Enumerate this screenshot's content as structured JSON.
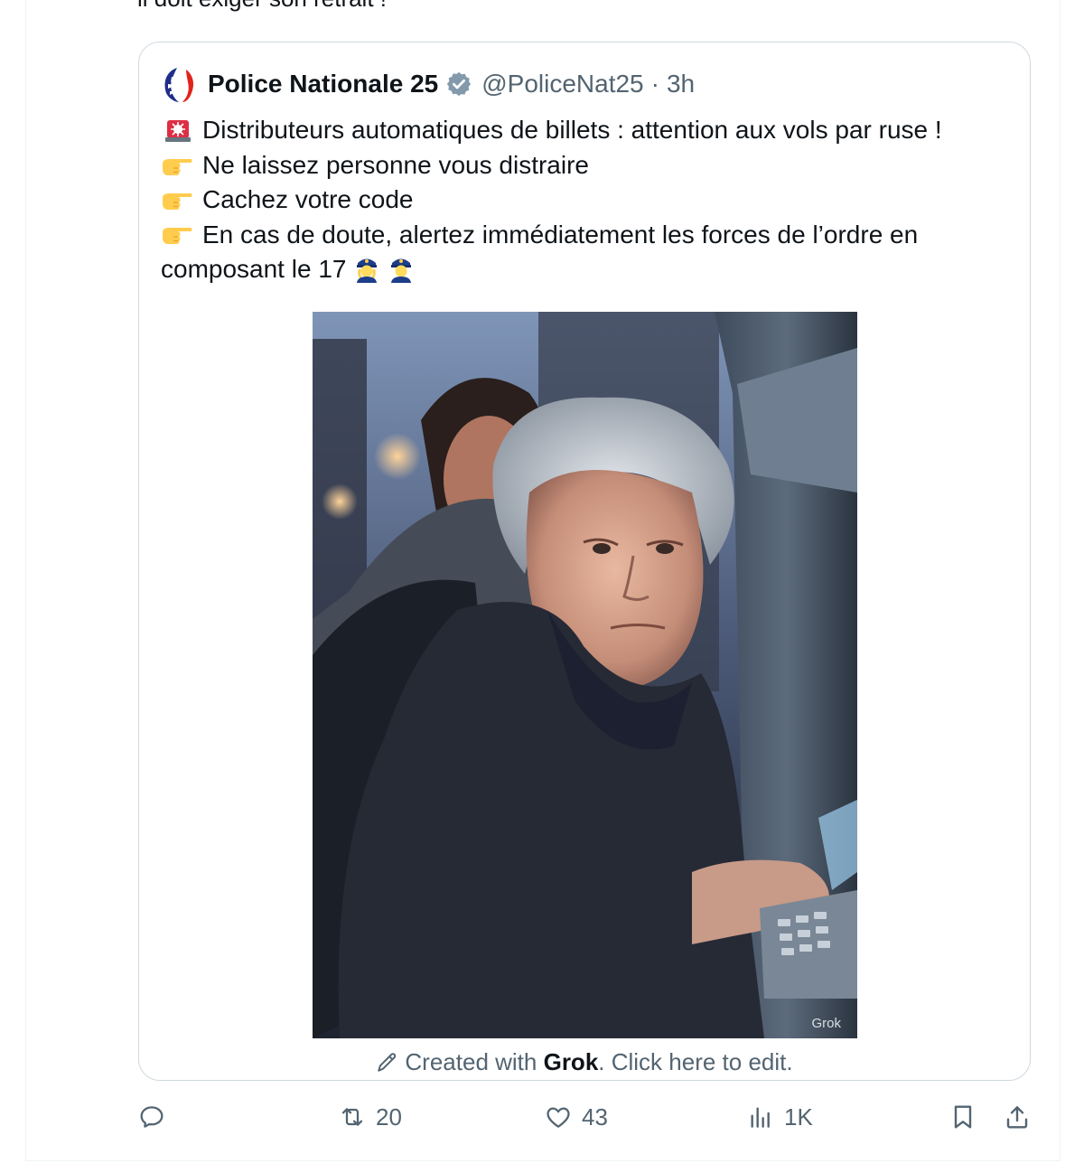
{
  "previous_tweet_tail": "il doit exiger son retrait !",
  "quoted_tweet": {
    "author_name": "Police Nationale 25",
    "handle": "@PoliceNat25",
    "separator": "·",
    "time": "3h",
    "lines": [
      "Distributeurs automatiques de billets : attention aux vols par ruse !",
      "Ne laissez personne vous distraire",
      "Cachez votre code",
      "En cas de doute, alertez immédiatement les forces de l’ordre en composant le 17"
    ],
    "image_watermark": "Grok",
    "created_with_prefix": "Created with ",
    "created_with_brand": "Grok",
    "created_with_suffix": ".  Click here to edit."
  },
  "actions": {
    "reply_count": "",
    "retweet_count": "20",
    "like_count": "43",
    "views_count": "1K"
  },
  "colors": {
    "text": "#0f1419",
    "secondary": "#536471",
    "border": "#cfd9de",
    "verified": "#829aab"
  }
}
